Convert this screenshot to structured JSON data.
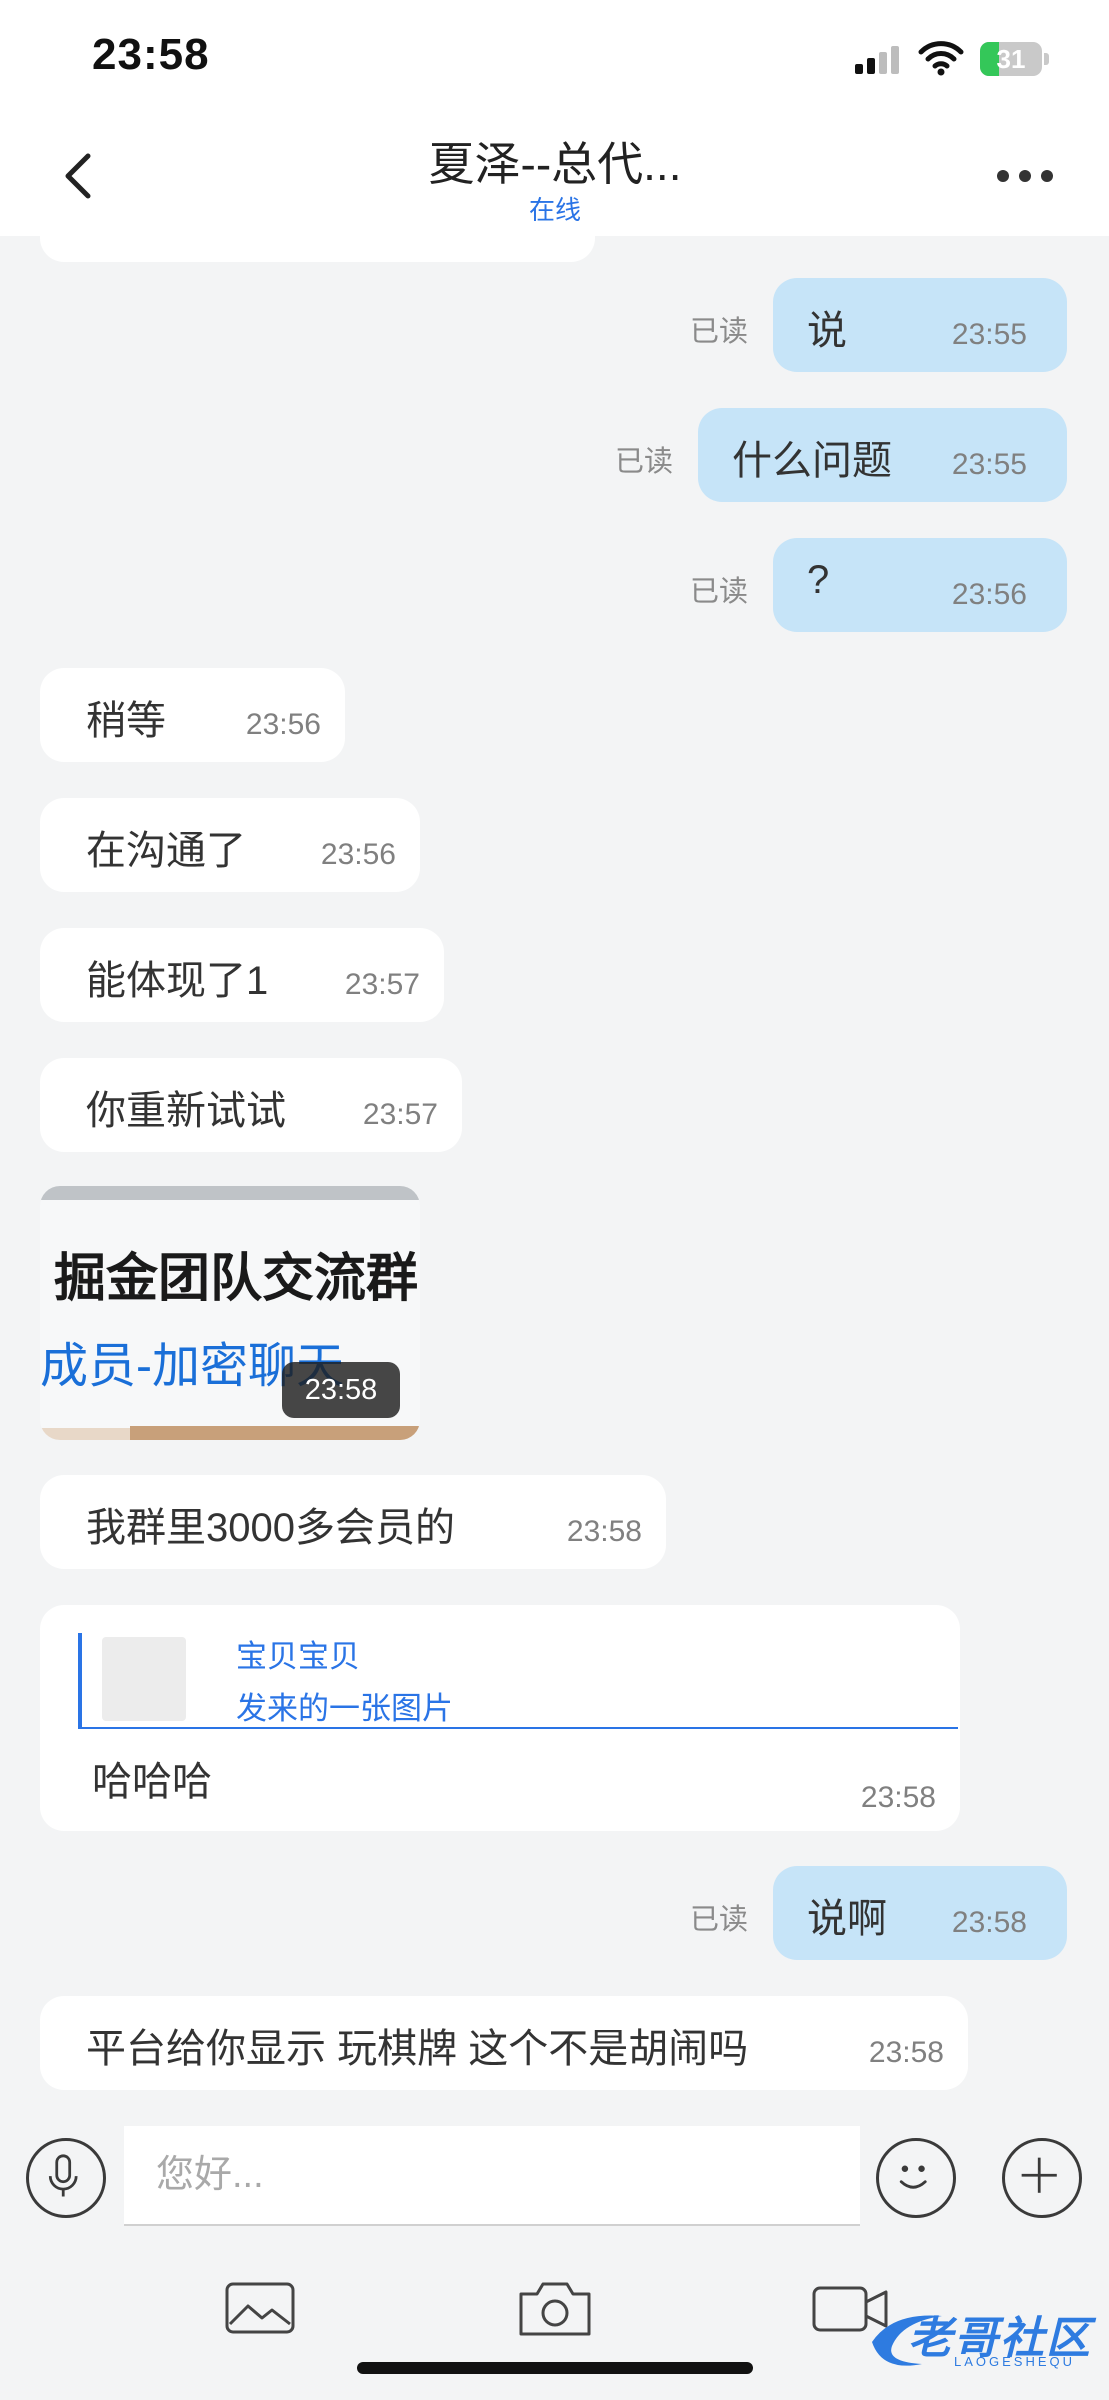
{
  "status_bar": {
    "time": "23:58",
    "battery": "31",
    "battery_level": 0.31
  },
  "header": {
    "title": "夏泽--总代...",
    "subtitle": "在线"
  },
  "messages": [
    {
      "direction": "out",
      "text": "说",
      "time": "23:55",
      "read_label": "已读"
    },
    {
      "direction": "out",
      "text": "什么问题",
      "time": "23:55",
      "read_label": "已读"
    },
    {
      "direction": "out",
      "text": "?",
      "time": "23:56",
      "read_label": "已读"
    },
    {
      "direction": "in",
      "text": "稍等",
      "time": "23:56"
    },
    {
      "direction": "in",
      "text": "在沟通了",
      "time": "23:56"
    },
    {
      "direction": "in",
      "text": "能体现了1",
      "time": "23:57"
    },
    {
      "direction": "in",
      "text": "你重新试试",
      "time": "23:57"
    },
    {
      "direction": "in",
      "type": "image",
      "image_line1": "掘金团队交流群",
      "image_line2": "成员-加密聊天",
      "time": "23:58"
    },
    {
      "direction": "in",
      "text": "我群里3000多会员的",
      "time": "23:58"
    },
    {
      "direction": "in",
      "type": "quote",
      "quote_name": "宝贝宝贝",
      "quote_desc": "发来的一张图片",
      "text": "哈哈哈",
      "time": "23:58"
    },
    {
      "direction": "out",
      "text": "说啊",
      "time": "23:58",
      "read_label": "已读"
    },
    {
      "direction": "in",
      "text": "平台给你显示 玩棋牌 这个不是胡闹吗",
      "time": "23:58"
    }
  ],
  "input": {
    "placeholder": "您好..."
  },
  "icons": {
    "back": "chevron-left-icon",
    "more": "more-icon",
    "mic": "mic-icon",
    "emoji": "emoji-icon",
    "plus": "plus-icon",
    "image": "image-icon",
    "camera": "camera-icon",
    "video": "video-icon"
  },
  "watermark": {
    "text": "老哥社区",
    "sub": "LAOGESHEQU"
  },
  "colors": {
    "outgoing_bubble": "#c6e4f8",
    "incoming_bubble": "#ffffff",
    "accent": "#2a74e6",
    "background": "#f3f4f5"
  }
}
